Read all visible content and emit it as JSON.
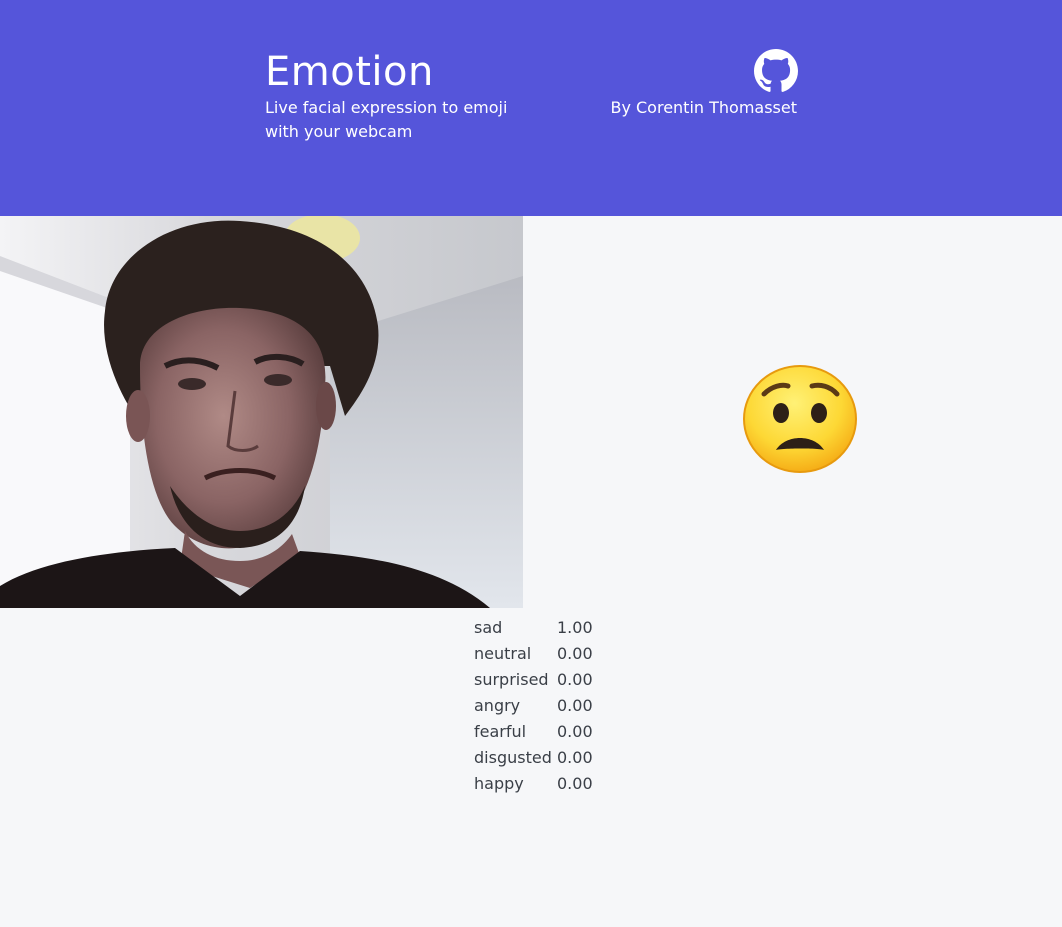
{
  "header": {
    "title": "Emotion",
    "subtitle": "Live facial expression to emoji with your webcam",
    "author": "By Corentin Thomasset",
    "github_icon": "github-icon",
    "background_color": "#5555da"
  },
  "webcam": {
    "content": "webcam-video-feed"
  },
  "detected": {
    "emoji_icon": "anxious-face-emoji"
  },
  "scores": [
    {
      "label": "sad",
      "value": "1.00"
    },
    {
      "label": "neutral",
      "value": "0.00"
    },
    {
      "label": "surprised",
      "value": "0.00"
    },
    {
      "label": "angry",
      "value": "0.00"
    },
    {
      "label": "fearful",
      "value": "0.00"
    },
    {
      "label": "disgusted",
      "value": "0.00"
    },
    {
      "label": "happy",
      "value": "0.00"
    }
  ]
}
